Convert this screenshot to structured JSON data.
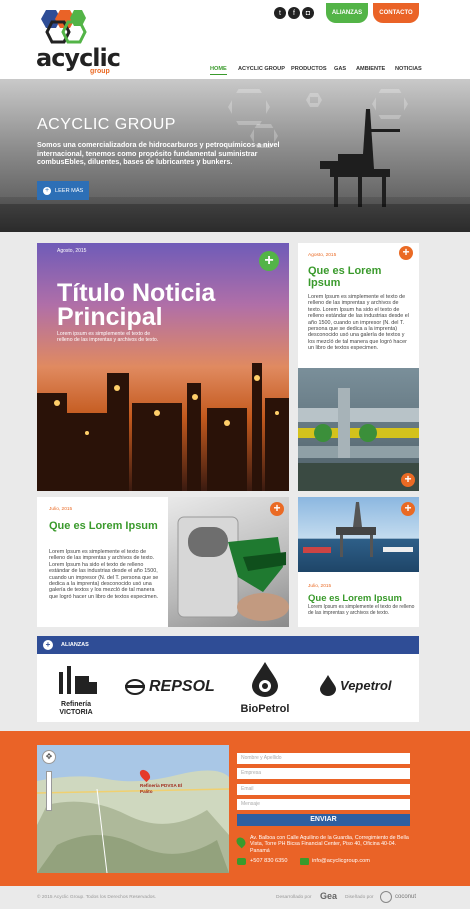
{
  "brand": {
    "name": "acyclic",
    "sub": "group"
  },
  "header": {
    "social": [
      "twitter-icon",
      "facebook-icon",
      "instagram-icon"
    ],
    "alianzas_btn": "ALIANZAS",
    "contacto_btn": "CONTACTO",
    "nav": [
      "HOME",
      "ACYCLIC GROUP",
      "PRODUCTOS",
      "GAS",
      "AMBIENTE",
      "NOTICIAS"
    ]
  },
  "hero": {
    "title": "ACYCLIC GROUP",
    "description": "Somos una comercializadora de hidrocarburos y petroquímicos a nivel internacional, tenemos como propósito fundamental suministrar combusEbles, diluentes, bases de lubricantes y bunkers.",
    "button": "LEER MÁS"
  },
  "main_news": {
    "date": "Agosto, 2015",
    "title": "Título Noticia Principal",
    "text": "Lorem ipsum es simplemente el texto de relleno de las imprentas y archivos de texto."
  },
  "card_right1": {
    "date": "Agosto, 2015",
    "title": "Que es Lorem Ipsum",
    "text": "Lorem Ipsum es simplemente el texto de relleno de las imprentas y archivos de texto. Lorem Ipsum ha sido el texto de relleno estándar de las industrias desde el año 1500, cuando un impresor (N. del T. persona que se dedica a la imprenta) desconocido usó una galería de textos y los mezcló de tal manera que logró hacer un libro de textos especimen."
  },
  "card_left2": {
    "date": "Julio, 2015",
    "title": "Que es Lorem Ipsum",
    "text": "Lorem Ipsum es simplemente el texto de relleno de las imprentas y archivos de texto. Lorem Ipsum ha sido el texto de relleno estándar de las industrias desde el año 1500, cuando un impresor (N. del T. persona que se dedica a la imprenta) desconocido usó una galería de textos y los mezcló de tal manera que logró hacer un libro de textos especimen."
  },
  "card_right2": {
    "date": "Julio, 2015",
    "title": "Que es Lorem Ipsum",
    "text": "Lorem Ipsum es simplemente el texto de relleno de las imprentas y archivos de texto."
  },
  "alliances": {
    "label": "ALIANZAS",
    "logos": [
      "Refinería VICTORIA",
      "REPSOL",
      "BioPetrol",
      "Vepetrol"
    ]
  },
  "map": {
    "place": "Refinería PDVSA El Palito"
  },
  "form": {
    "placeholders": [
      "Nombre y Apellido",
      "Empresa",
      "Email",
      "Mensaje"
    ],
    "submit": "ENVIAR"
  },
  "contact_info": {
    "address": "Av. Balboa con Calle Aquilino de la Guardia, Corregimiento de Bella Vista, Torre PH Bicsa Financial Center, Piso 40, Oficina 40-04. Panamá",
    "phone": "+507 830 6350",
    "email": "info@acyclicgroup.com"
  },
  "footer": {
    "copyright": "© 2015 Acyclic Group. Todos los Derechos Reservados.",
    "dev_label": "Desarrollado por",
    "dev_name": "Gea",
    "design_label": "Diseñado por",
    "design_name": "coconut"
  },
  "colors": {
    "green": "#53b447",
    "orange": "#ea6327",
    "blue": "#2f4d96",
    "title_green": "#3a9a2c"
  }
}
